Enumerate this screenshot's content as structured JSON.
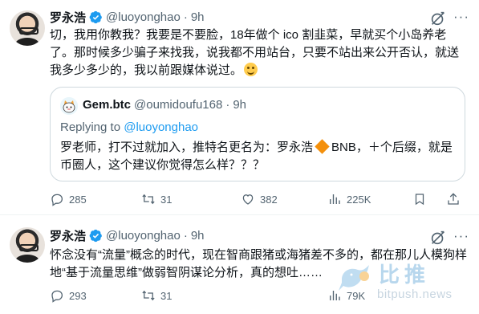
{
  "tweets": [
    {
      "author_name": "罗永浩",
      "handle": "@luoyonghao",
      "dot": "·",
      "time": "9h",
      "text": "切，我用你教我？我要是不要脸，18年做个 ico 割韭菜，早就买个小岛养老了。那时候多少骗子来找我，说我都不用站台，只要不站出来公开否认，就送我多少多少的，我以前跟媒体说过。",
      "quote": {
        "author_name": "Gem.btc",
        "handle": "@oumidoufu168",
        "dot": "·",
        "time": "9h",
        "replying_prefix": "Replying to",
        "replying_handle": "@luoyonghao",
        "text_before": "罗老师，打不过就加入，推特名更名为：罗永浩",
        "text_after": "BNB，＋个后缀，就是币圈人，这个建议你觉得怎么样？？？"
      },
      "replies": "285",
      "retweets": "31",
      "likes": "382",
      "views": "225K"
    },
    {
      "author_name": "罗永浩",
      "handle": "@luoyonghao",
      "dot": "·",
      "time": "9h",
      "text": "怀念没有“流量”概念的时代，现在智商跟猪或海猪差不多的，都在那儿人模狗样地“基于流量思维”做弱智阴谋论分析，真的想吐……",
      "replies": "293",
      "retweets": "31",
      "likes": "",
      "views": "79K"
    }
  ],
  "more_glyph": "···",
  "watermark": {
    "cn": "比推",
    "en": "bitpush.news"
  },
  "colors": {
    "accent": "#1d9bf0",
    "muted": "#536471",
    "text": "#0f1419",
    "border": "#cfd9de"
  },
  "icons": [
    "verified-badge-icon",
    "grok-icon",
    "more-icon",
    "reply-icon",
    "retweet-icon",
    "like-icon",
    "views-icon",
    "bookmark-icon",
    "share-icon"
  ]
}
